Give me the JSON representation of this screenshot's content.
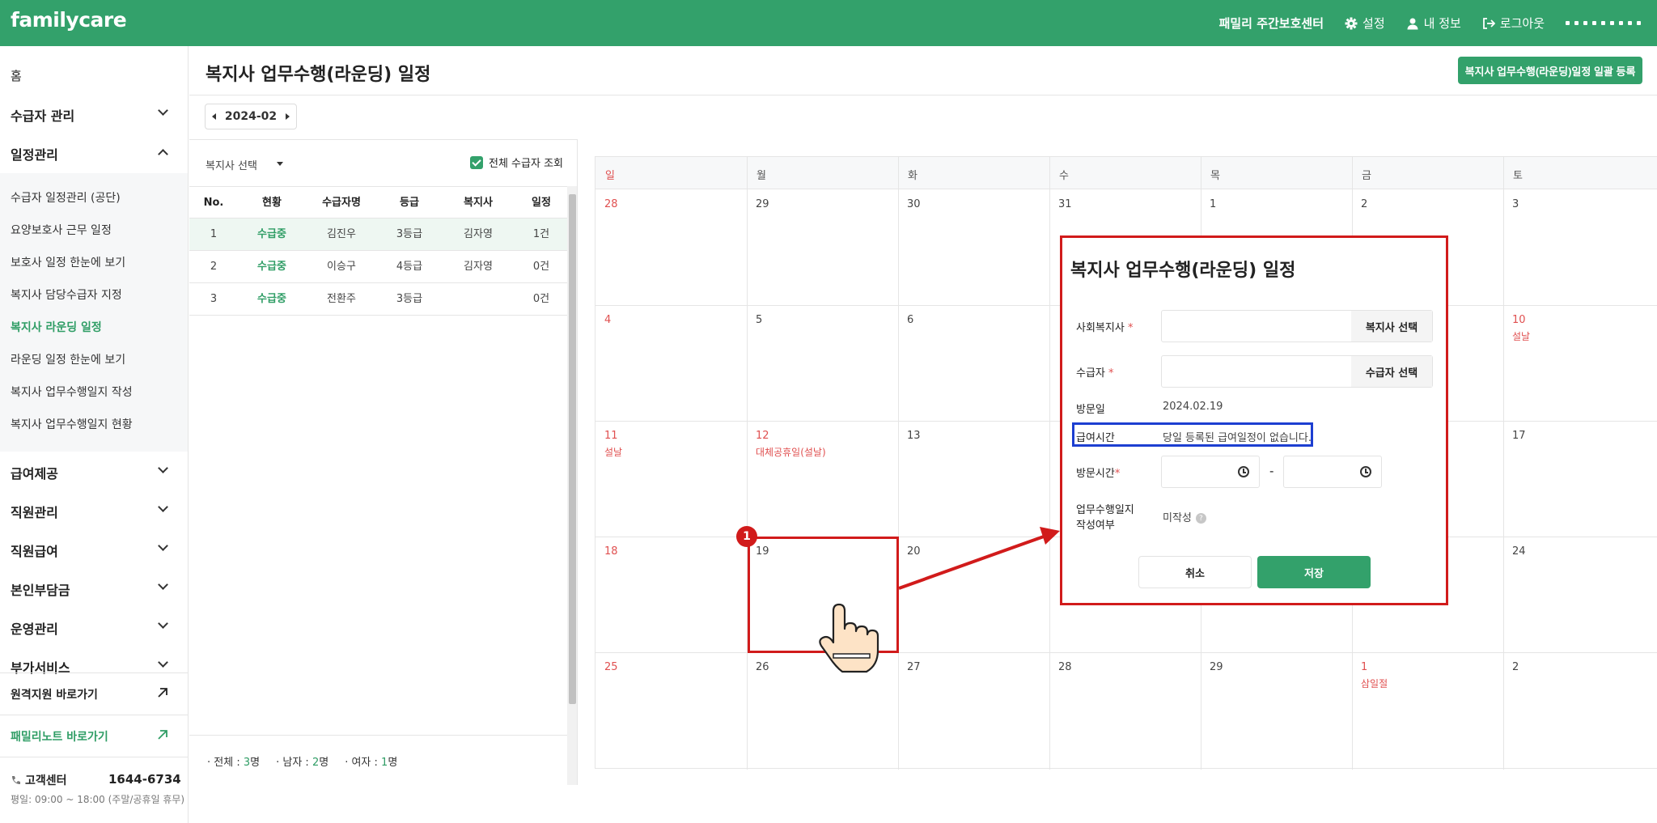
{
  "app": {
    "logo": "familycare"
  },
  "topbar": {
    "org_name": "패밀리 주간보호센터",
    "settings": "설정",
    "my_info": "내 정보",
    "logout": "로그아웃"
  },
  "sidebar": {
    "home": "홈",
    "recipient_mgmt": "수급자 관리",
    "schedule_mgmt": "일정관리",
    "sub_items": [
      "수급자 일정관리 (공단)",
      "요양보호사 근무 일정",
      "보호사 일정 한눈에 보기",
      "복지사 담당수급자 지정",
      "복지사 라운딩 일정",
      "라운딩 일정 한눈에 보기",
      "복지사 업무수행일지 작성",
      "복지사 업무수행일지 현황"
    ],
    "benefit": "급여제공",
    "staff_mgmt": "직원관리",
    "staff_pay": "직원급여",
    "copay": "본인부담금",
    "operation": "운영관리",
    "addon": "부가서비스",
    "remote_support": "원격지원 바로가기",
    "family_note": "패밀리노트 바로가기",
    "cs_label": "고객센터",
    "cs_number": "1644-6734",
    "cs_hours": "평일: 09:00 ~ 18:00 (주말/공휴일 휴무)"
  },
  "page": {
    "title": "복지사 업무수행(라운딩) 일정",
    "bulk_button": "복지사 업무수행(라운딩)일정 일괄 등록",
    "month": "2024-02"
  },
  "list": {
    "worker_select": "복지사 선택",
    "show_all": "전체 수급자 조회",
    "headers": [
      "No.",
      "현황",
      "수급자명",
      "등급",
      "복지사",
      "일정"
    ],
    "rows": [
      [
        "1",
        "수급중",
        "김진우",
        "3등급",
        "김자영",
        "1건"
      ],
      [
        "2",
        "수급중",
        "이승구",
        "4등급",
        "김자영",
        "0건"
      ],
      [
        "3",
        "수급중",
        "전환주",
        "3등급",
        "",
        "0건"
      ]
    ],
    "summary": {
      "total_label": "전체 : ",
      "total": "3",
      "total_unit": "명",
      "male_label": "남자 : ",
      "male": "2",
      "male_unit": "명",
      "female_label": "여자 : ",
      "female": "1",
      "female_unit": "명"
    }
  },
  "calendar": {
    "days": [
      "일",
      "월",
      "화",
      "수",
      "목",
      "금",
      "토"
    ],
    "weeks": [
      [
        "28",
        "29",
        "30",
        "31",
        "1",
        "2",
        "3"
      ],
      [
        "4",
        "5",
        "6",
        "",
        "",
        "",
        "10"
      ],
      [
        "11",
        "12",
        "13",
        "",
        "",
        "",
        "17"
      ],
      [
        "18",
        "19",
        "20",
        "",
        "",
        "",
        "24"
      ],
      [
        "25",
        "26",
        "27",
        "28",
        "29",
        "1",
        "2"
      ]
    ],
    "holidays": {
      "w1d6": "설날",
      "w2d0": "설날",
      "w2d1": "대체공휴일(설날)",
      "w4d5": "삼일절"
    }
  },
  "annotation": {
    "badge": "1"
  },
  "modal": {
    "title": "복지사 업무수행(라운딩) 일정",
    "social_worker_label": "사회복지사",
    "social_worker_btn": "복지사 선택",
    "recipient_label": "수급자",
    "recipient_btn": "수급자 선택",
    "visit_date_label": "방문일",
    "visit_date": "2024.02.19",
    "benefit_time_label": "급여시간",
    "benefit_time": "당일 등록된 급여일정이 없습니다.",
    "visit_time_label": "방문시간",
    "time_sep": "-",
    "log_label_1": "업무수행일지",
    "log_label_2": "작성여부",
    "log_status": "미작성",
    "help_mark": "?",
    "req_mark": "*",
    "cancel": "취소",
    "save": "저장"
  },
  "colors": {
    "brand": "#33a16b",
    "holiday": "#e05050",
    "annotation_red": "#d11b1b",
    "annotation_blue": "#1d3fd1"
  }
}
